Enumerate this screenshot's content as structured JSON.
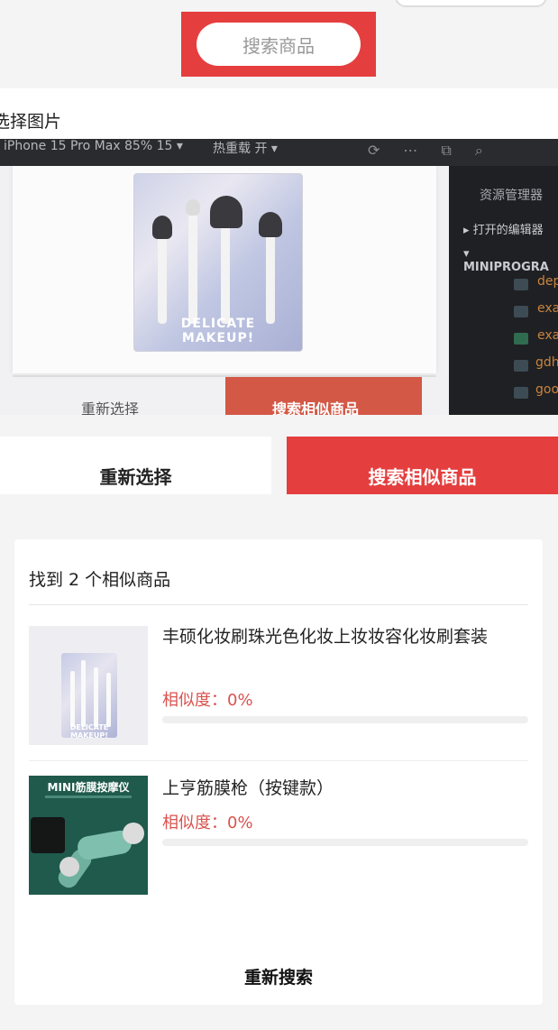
{
  "header": {
    "search_label": "搜索商品"
  },
  "choose_image": {
    "title": "选择图片"
  },
  "photo_preview": {
    "device_label": "iPhone 15 Pro Max 85% 15 ▾",
    "reload_label": "热重载 开 ▾",
    "explorer_title": "资源管理器",
    "open_editors": "打开的编辑器",
    "project_root": "MINIPROGRA",
    "files": [
      "dep",
      "exa",
      "exa",
      "gdh",
      "goo"
    ],
    "product_box_label": "DELICATE MAKEUP!",
    "reselect_label": "重新选择",
    "search_similar_label": "搜索相似商品"
  },
  "actions": {
    "reselect_label": "重新选择",
    "search_similar_label": "搜索相似商品"
  },
  "results": {
    "title": "找到 2 个相似商品",
    "items": [
      {
        "name": "丰硕化妆刷珠光色化妆上妆妆容化妆刷套装",
        "similarity_text": "相似度：0%",
        "similarity": 0,
        "thumb_label": "DELICATE MAKEUP!"
      },
      {
        "name": "上亨筋膜枪（按键款）",
        "similarity_text": "相似度：0%",
        "similarity": 0,
        "thumb_label": "MINI筋膜按摩仪"
      }
    ],
    "research_label": "重新搜索"
  },
  "colors": {
    "accent": "#e53e3e",
    "similarity": "#d9534f",
    "background": "#f4f4f4"
  }
}
